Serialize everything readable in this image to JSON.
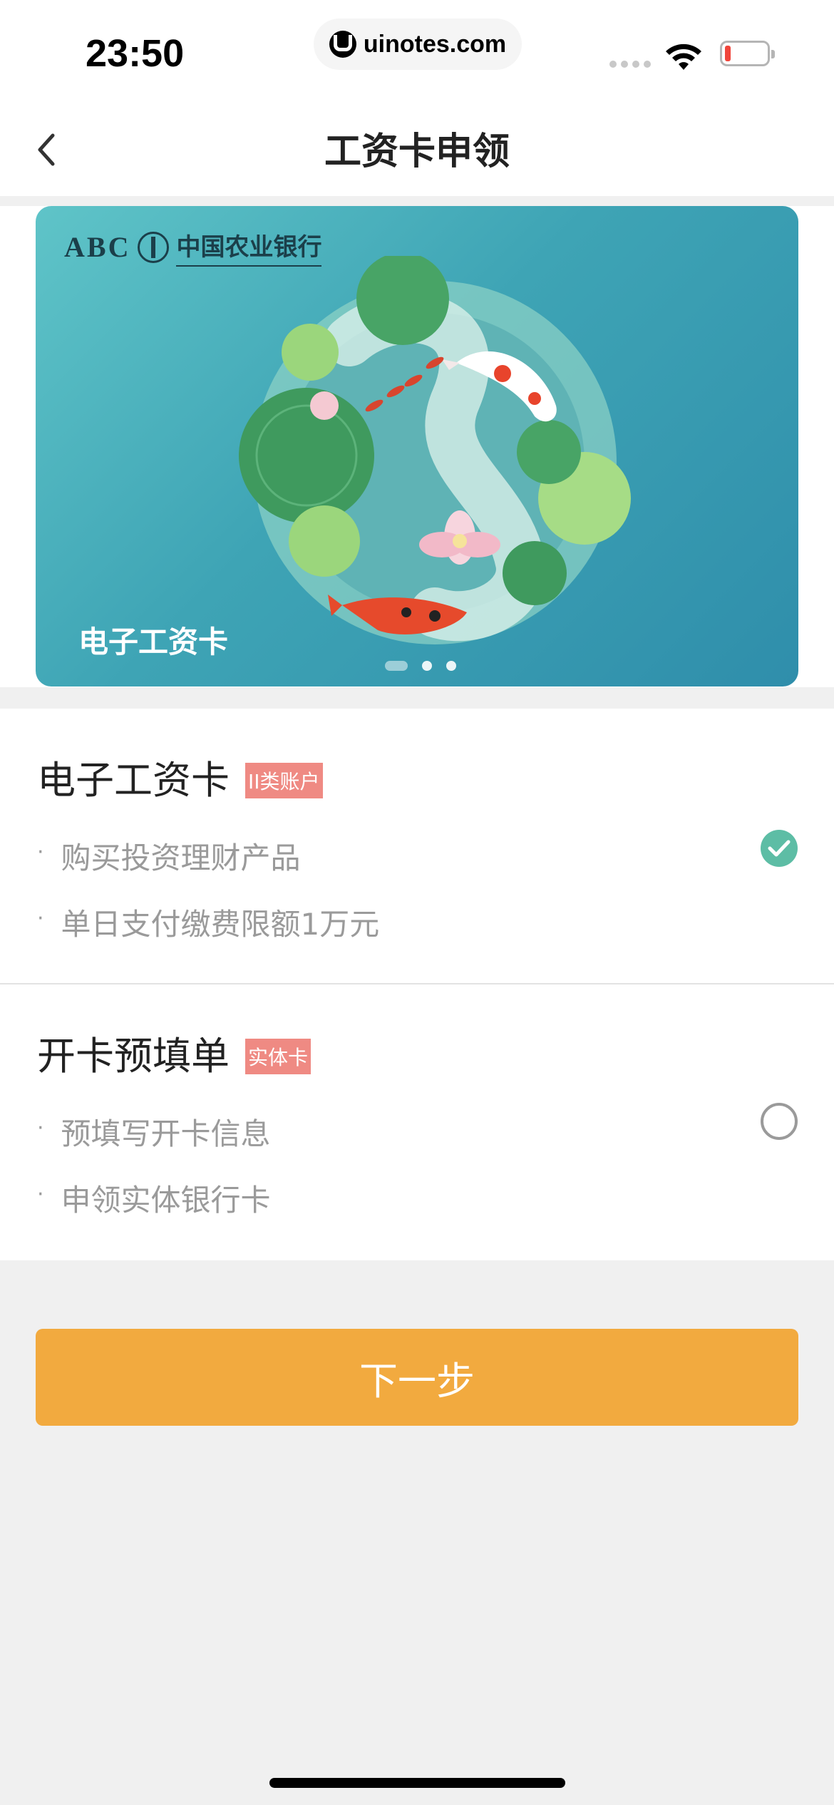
{
  "status_bar": {
    "time": "23:50",
    "url": "uinotes.com",
    "icons": [
      "cellular-signal-icon",
      "wifi-icon",
      "battery-low-icon"
    ],
    "battery_level": 0.1
  },
  "nav": {
    "title": "工资卡申领",
    "back_icon": "chevron-left-icon"
  },
  "banner": {
    "bank_logo_abc": "ABC",
    "bank_name": "中国农业银行",
    "card_caption": "电子工资卡",
    "carousel": {
      "slides": 3,
      "active": 1
    }
  },
  "options": [
    {
      "name": "电子工资卡",
      "badge": "II类账户",
      "bullets": [
        "购买投资理财产品",
        "单日支付缴费限额1万元"
      ],
      "selected": true
    },
    {
      "name": "开卡预填单",
      "badge": "实体卡",
      "bullets": [
        "预填写开卡信息",
        "申领实体银行卡"
      ],
      "selected": false
    }
  ],
  "next_button": "下一步",
  "colors": {
    "accent_orange": "#f2aa3f",
    "check_green": "#5dbda5",
    "badge_red": "#ef8a83",
    "background": "#f0f0f0"
  }
}
